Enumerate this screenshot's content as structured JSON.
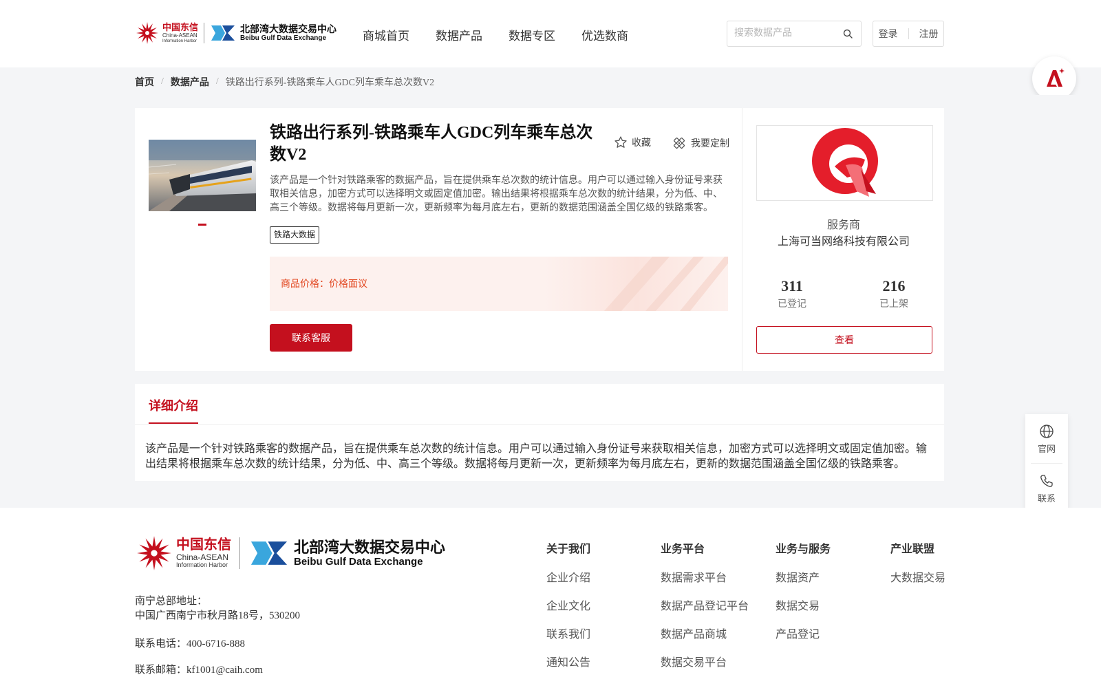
{
  "header": {
    "logo_cn": {
      "line1": "中国东信",
      "line2": "China-ASEAN",
      "line3": "Information Harbor"
    },
    "logo_bg": {
      "line1": "北部湾大数据交易中心",
      "line2": "Beibu Gulf Data Exchange"
    },
    "nav": [
      "商城首页",
      "数据产品",
      "数据专区",
      "优选数商"
    ],
    "search_placeholder": "搜索数据产品",
    "login": "登录",
    "register": "注册"
  },
  "breadcrumb": {
    "home": "首页",
    "category": "数据产品",
    "current": "铁路出行系列-铁路乘车人GDC列车乘车总次数V2"
  },
  "product": {
    "title": "铁路出行系列-铁路乘车人GDC列车乘车总次数V2",
    "favorite": "收藏",
    "customize": "我要定制",
    "description": "该产品是一个针对铁路乘客的数据产品，旨在提供乘车总次数的统计信息。用户可以通过输入身份证号来获取相关信息，加密方式可以选择明文或固定值加密。输出结果将根据乘车总次数的统计结果，分为低、中、高三个等级。数据将每月更新一次，更新频率为每月底左右，更新的数据范围涵盖全国亿级的铁路乘客。",
    "tag": "铁路大数据",
    "price_label": "商品价格：",
    "price_value": "价格面议",
    "contact_button": "联系客服"
  },
  "provider": {
    "label": "服务商",
    "name": "上海可当网络科技有限公司",
    "registered_count": "311",
    "registered_label": "已登记",
    "listed_count": "216",
    "listed_label": "已上架",
    "view_button": "查看"
  },
  "detail": {
    "tab": "详细介绍",
    "text": "该产品是一个针对铁路乘客的数据产品，旨在提供乘车总次数的统计信息。用户可以通过输入身份证号来获取相关信息，加密方式可以选择明文或固定值加密。输出结果将根据乘车总次数的统计结果，分为低、中、高三个等级。数据将每月更新一次，更新频率为每月底左右，更新的数据范围涵盖全国亿级的铁路乘客。"
  },
  "side_tools": {
    "website": "官网",
    "contact": "联系"
  },
  "footer": {
    "address_label": "南宁总部地址：",
    "address": "中国广西南宁市秋月路18号，530200",
    "phone": "联系电话：400-6716-888",
    "email": "联系邮箱：kf1001@caih.com",
    "columns": [
      {
        "title": "关于我们",
        "items": [
          "企业介绍",
          "企业文化",
          "联系我们",
          "通知公告"
        ]
      },
      {
        "title": "业务平台",
        "items": [
          "数据需求平台",
          "数据产品登记平台",
          "数据产品商城",
          "数据交易平台"
        ]
      },
      {
        "title": "业务与服务",
        "items": [
          "数据资产",
          "数据交易",
          "产品登记"
        ]
      },
      {
        "title": "产业联盟",
        "items": [
          "大数据交易"
        ]
      }
    ]
  },
  "colors": {
    "brand_red": "#c4101e",
    "price_orange": "#e2461f",
    "page_bg": "#f4f5f7"
  },
  "icons": [
    "search-icon",
    "star-icon",
    "customize-icon",
    "globe-icon",
    "phone-icon"
  ]
}
